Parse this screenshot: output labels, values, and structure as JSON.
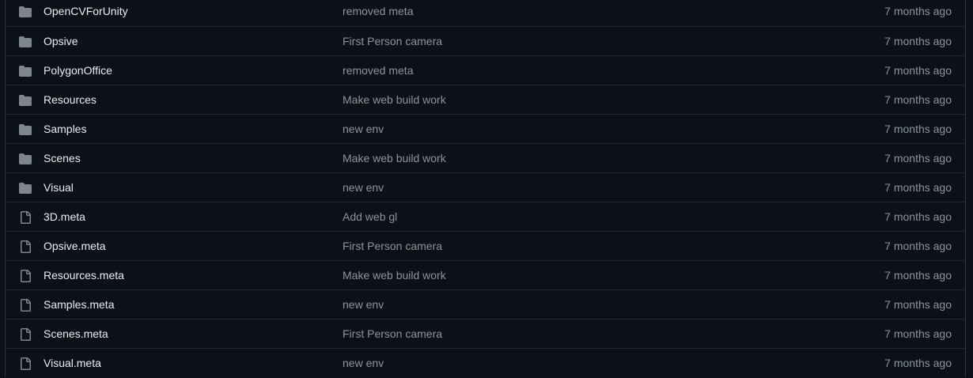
{
  "colors": {
    "background": "#0d1117",
    "row_border": "#21262d",
    "name_text": "#e6edf3",
    "muted_text": "#8b949e",
    "folder_icon": "#7d8590",
    "file_icon": "#7d8590"
  },
  "rows": [
    {
      "type": "folder",
      "icon": "folder-icon",
      "name": "OpenCVForUnity",
      "commit": "removed meta",
      "time": "7 months ago"
    },
    {
      "type": "folder",
      "icon": "folder-icon",
      "name": "Opsive",
      "commit": "First Person camera",
      "time": "7 months ago"
    },
    {
      "type": "folder",
      "icon": "folder-icon",
      "name": "PolygonOffice",
      "commit": "removed meta",
      "time": "7 months ago"
    },
    {
      "type": "folder",
      "icon": "folder-icon",
      "name": "Resources",
      "commit": "Make web build work",
      "time": "7 months ago"
    },
    {
      "type": "folder",
      "icon": "folder-icon",
      "name": "Samples",
      "commit": "new env",
      "time": "7 months ago"
    },
    {
      "type": "folder",
      "icon": "folder-icon",
      "name": "Scenes",
      "commit": "Make web build work",
      "time": "7 months ago"
    },
    {
      "type": "folder",
      "icon": "folder-icon",
      "name": "Visual",
      "commit": "new env",
      "time": "7 months ago"
    },
    {
      "type": "file",
      "icon": "file-icon",
      "name": "3D.meta",
      "commit": "Add web gl",
      "time": "7 months ago"
    },
    {
      "type": "file",
      "icon": "file-icon",
      "name": "Opsive.meta",
      "commit": "First Person camera",
      "time": "7 months ago"
    },
    {
      "type": "file",
      "icon": "file-icon",
      "name": "Resources.meta",
      "commit": "Make web build work",
      "time": "7 months ago"
    },
    {
      "type": "file",
      "icon": "file-icon",
      "name": "Samples.meta",
      "commit": "new env",
      "time": "7 months ago"
    },
    {
      "type": "file",
      "icon": "file-icon",
      "name": "Scenes.meta",
      "commit": "First Person camera",
      "time": "7 months ago"
    },
    {
      "type": "file",
      "icon": "file-icon",
      "name": "Visual.meta",
      "commit": "new env",
      "time": "7 months ago"
    }
  ]
}
